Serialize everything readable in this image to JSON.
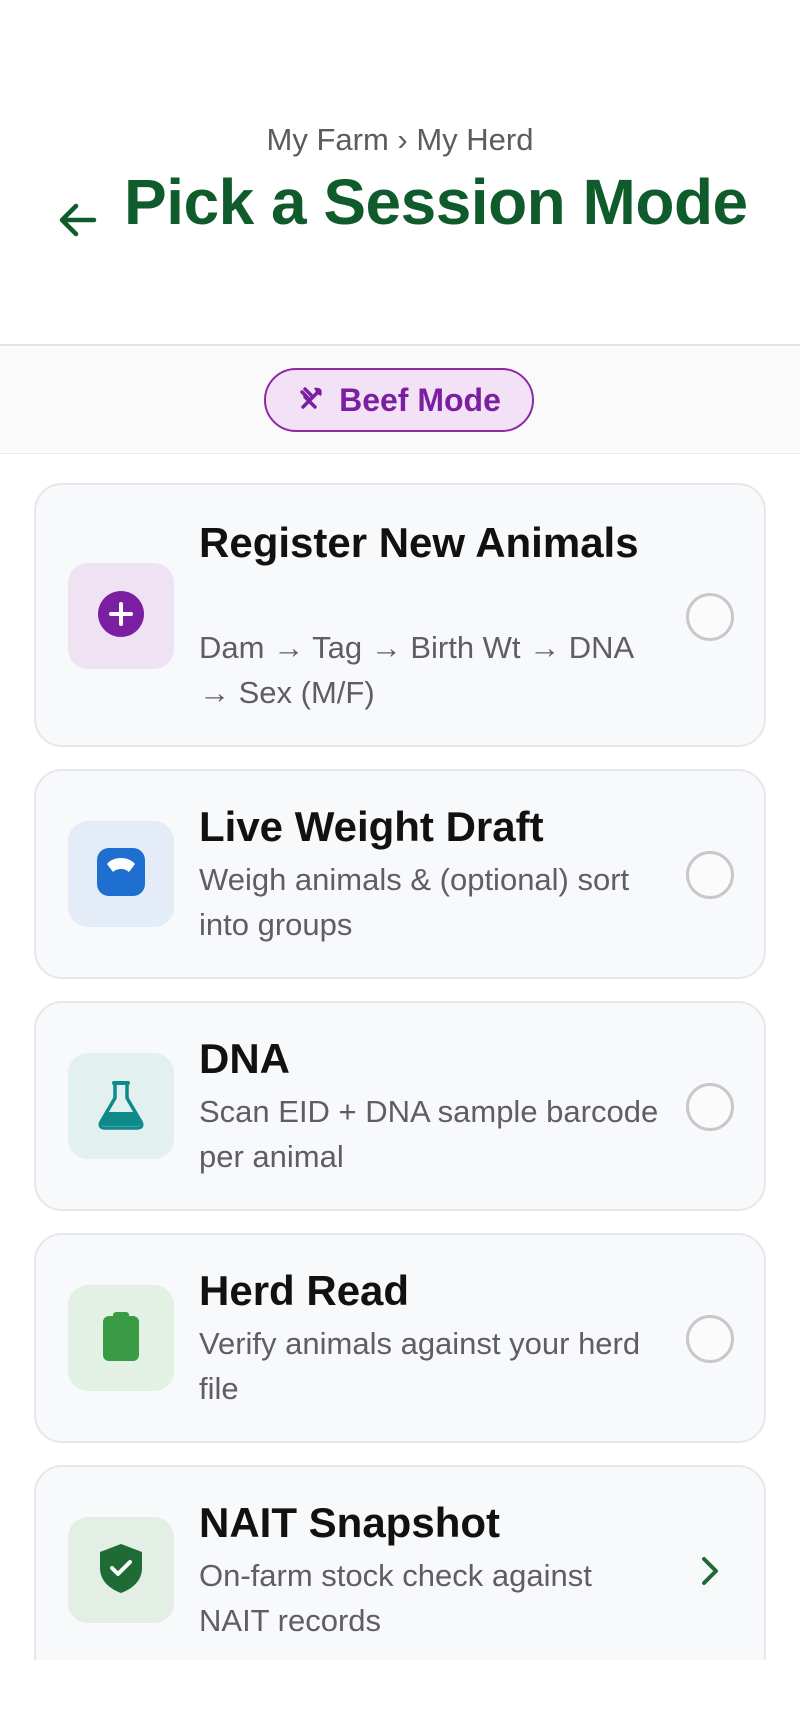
{
  "header": {
    "breadcrumb": "My Farm › My Herd",
    "title": "Pick a Session Mode"
  },
  "mode_badge": {
    "label": "Beef Mode",
    "color": "#7b1fa2"
  },
  "session_modes": [
    {
      "title": "Register New Animals",
      "description": "Dam → Tag → Birth Wt → DNA → Sex (M/F)",
      "icon": "plus-circle-icon",
      "selected": false
    },
    {
      "title": "Live Weight Draft",
      "description": "Weigh animals & (optional) sort into groups",
      "icon": "scale-icon",
      "selected": false
    },
    {
      "title": "DNA",
      "description": "Scan EID + DNA sample barcode per animal",
      "icon": "flask-icon",
      "selected": false
    },
    {
      "title": "Herd Read",
      "description": "Verify animals against your herd file",
      "icon": "clipboard-icon",
      "selected": false
    },
    {
      "title": "NAIT Snapshot",
      "description": "On-farm stock check against NAIT records",
      "icon": "shield-check-icon",
      "selected": false
    }
  ],
  "colors": {
    "title_green": "#0f5b2c",
    "accent_purple": "#7b1fa2",
    "scale_blue": "#1e6fd0",
    "flask_teal": "#0f8a8a",
    "clipboard_green": "#3a9b45",
    "shield_green": "#1e6b35"
  }
}
